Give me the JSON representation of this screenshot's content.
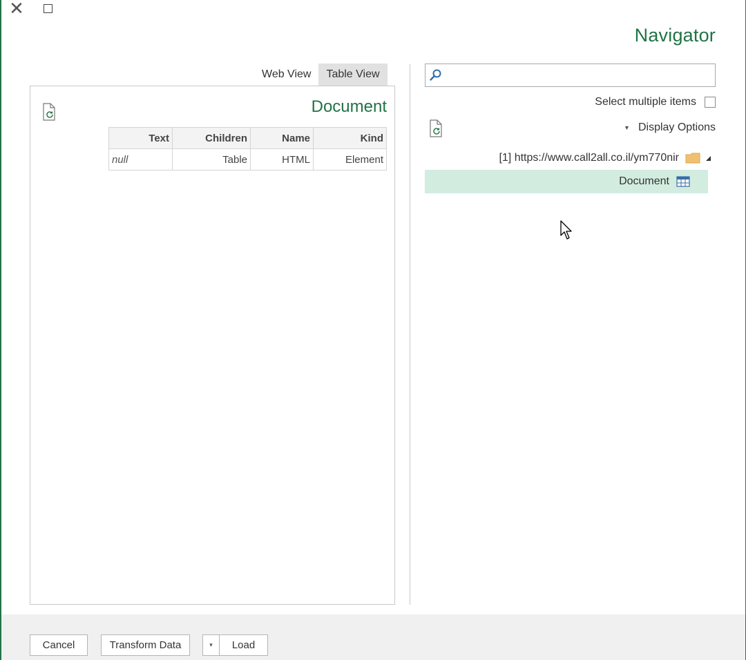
{
  "window": {
    "close_glyph": "✕",
    "title": "Navigator"
  },
  "preview": {
    "tabs": [
      {
        "label": "Web View",
        "active": false
      },
      {
        "label": "Table View",
        "active": true
      }
    ],
    "title": "Document",
    "table": {
      "headers": [
        "Text",
        "Children",
        "Name",
        "Kind"
      ],
      "rows": [
        [
          "null",
          "Table",
          "HTML",
          "Element"
        ]
      ]
    }
  },
  "navigator": {
    "search": {
      "value": "",
      "placeholder": ""
    },
    "select_multiple_label": "Select multiple items",
    "select_multiple_checked": false,
    "display_options_label": "Display Options",
    "tree": {
      "root_label": "[1] https://www.call2all.co.il/ym770nir",
      "root_icon": "folder-icon",
      "items": [
        {
          "label": "Document",
          "icon": "table-icon",
          "selected": true
        }
      ]
    }
  },
  "footer": {
    "cancel_label": "Cancel",
    "transform_label": "Transform Data",
    "load_label": "Load",
    "load_dropdown_glyph": "▾"
  },
  "colors": {
    "accent": "#217346",
    "selection": "#d2ece0",
    "folder": "#f0c070"
  }
}
